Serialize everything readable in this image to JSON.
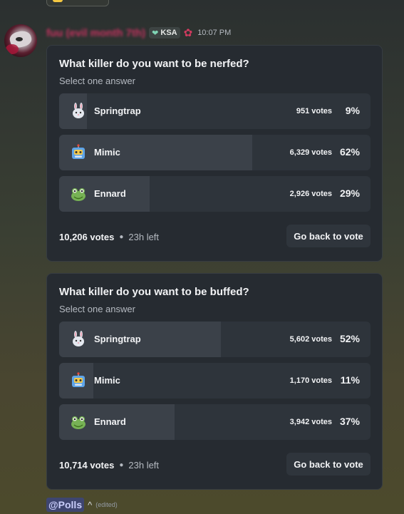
{
  "message": {
    "username": "fuu (evil month 7th)",
    "guild_tag": "KSA",
    "timestamp": "10:07 PM",
    "mention": "@Polls",
    "caret": "^",
    "edited": "(edited)"
  },
  "polls": [
    {
      "question": "What killer do you want to be nerfed?",
      "subtitle": "Select one answer",
      "answers": [
        {
          "label": "Springtrap",
          "emoji": "rabbit-icon",
          "votes": "951 votes",
          "percent": "9%",
          "share": 0.09
        },
        {
          "label": "Mimic",
          "emoji": "robot-icon",
          "votes": "6,329 votes",
          "percent": "62%",
          "share": 0.62
        },
        {
          "label": "Ennard",
          "emoji": "frog-icon",
          "votes": "2,926 votes",
          "percent": "29%",
          "share": 0.29
        }
      ],
      "total_votes": "10,206 votes",
      "time_left": "23h left",
      "button": "Go back to vote"
    },
    {
      "question": "What killer do you want to be buffed?",
      "subtitle": "Select one answer",
      "answers": [
        {
          "label": "Springtrap",
          "emoji": "rabbit-icon",
          "votes": "5,602 votes",
          "percent": "52%",
          "share": 0.52
        },
        {
          "label": "Mimic",
          "emoji": "robot-icon",
          "votes": "1,170 votes",
          "percent": "11%",
          "share": 0.11
        },
        {
          "label": "Ennard",
          "emoji": "frog-icon",
          "votes": "3,942 votes",
          "percent": "37%",
          "share": 0.37
        }
      ],
      "total_votes": "10,714 votes",
      "time_left": "23h left",
      "button": "Go back to vote"
    }
  ],
  "colors": {
    "username": "#c4325f",
    "card": "#262b31",
    "answer_bg": "#2e343b",
    "answer_fill": "#3b4149"
  }
}
